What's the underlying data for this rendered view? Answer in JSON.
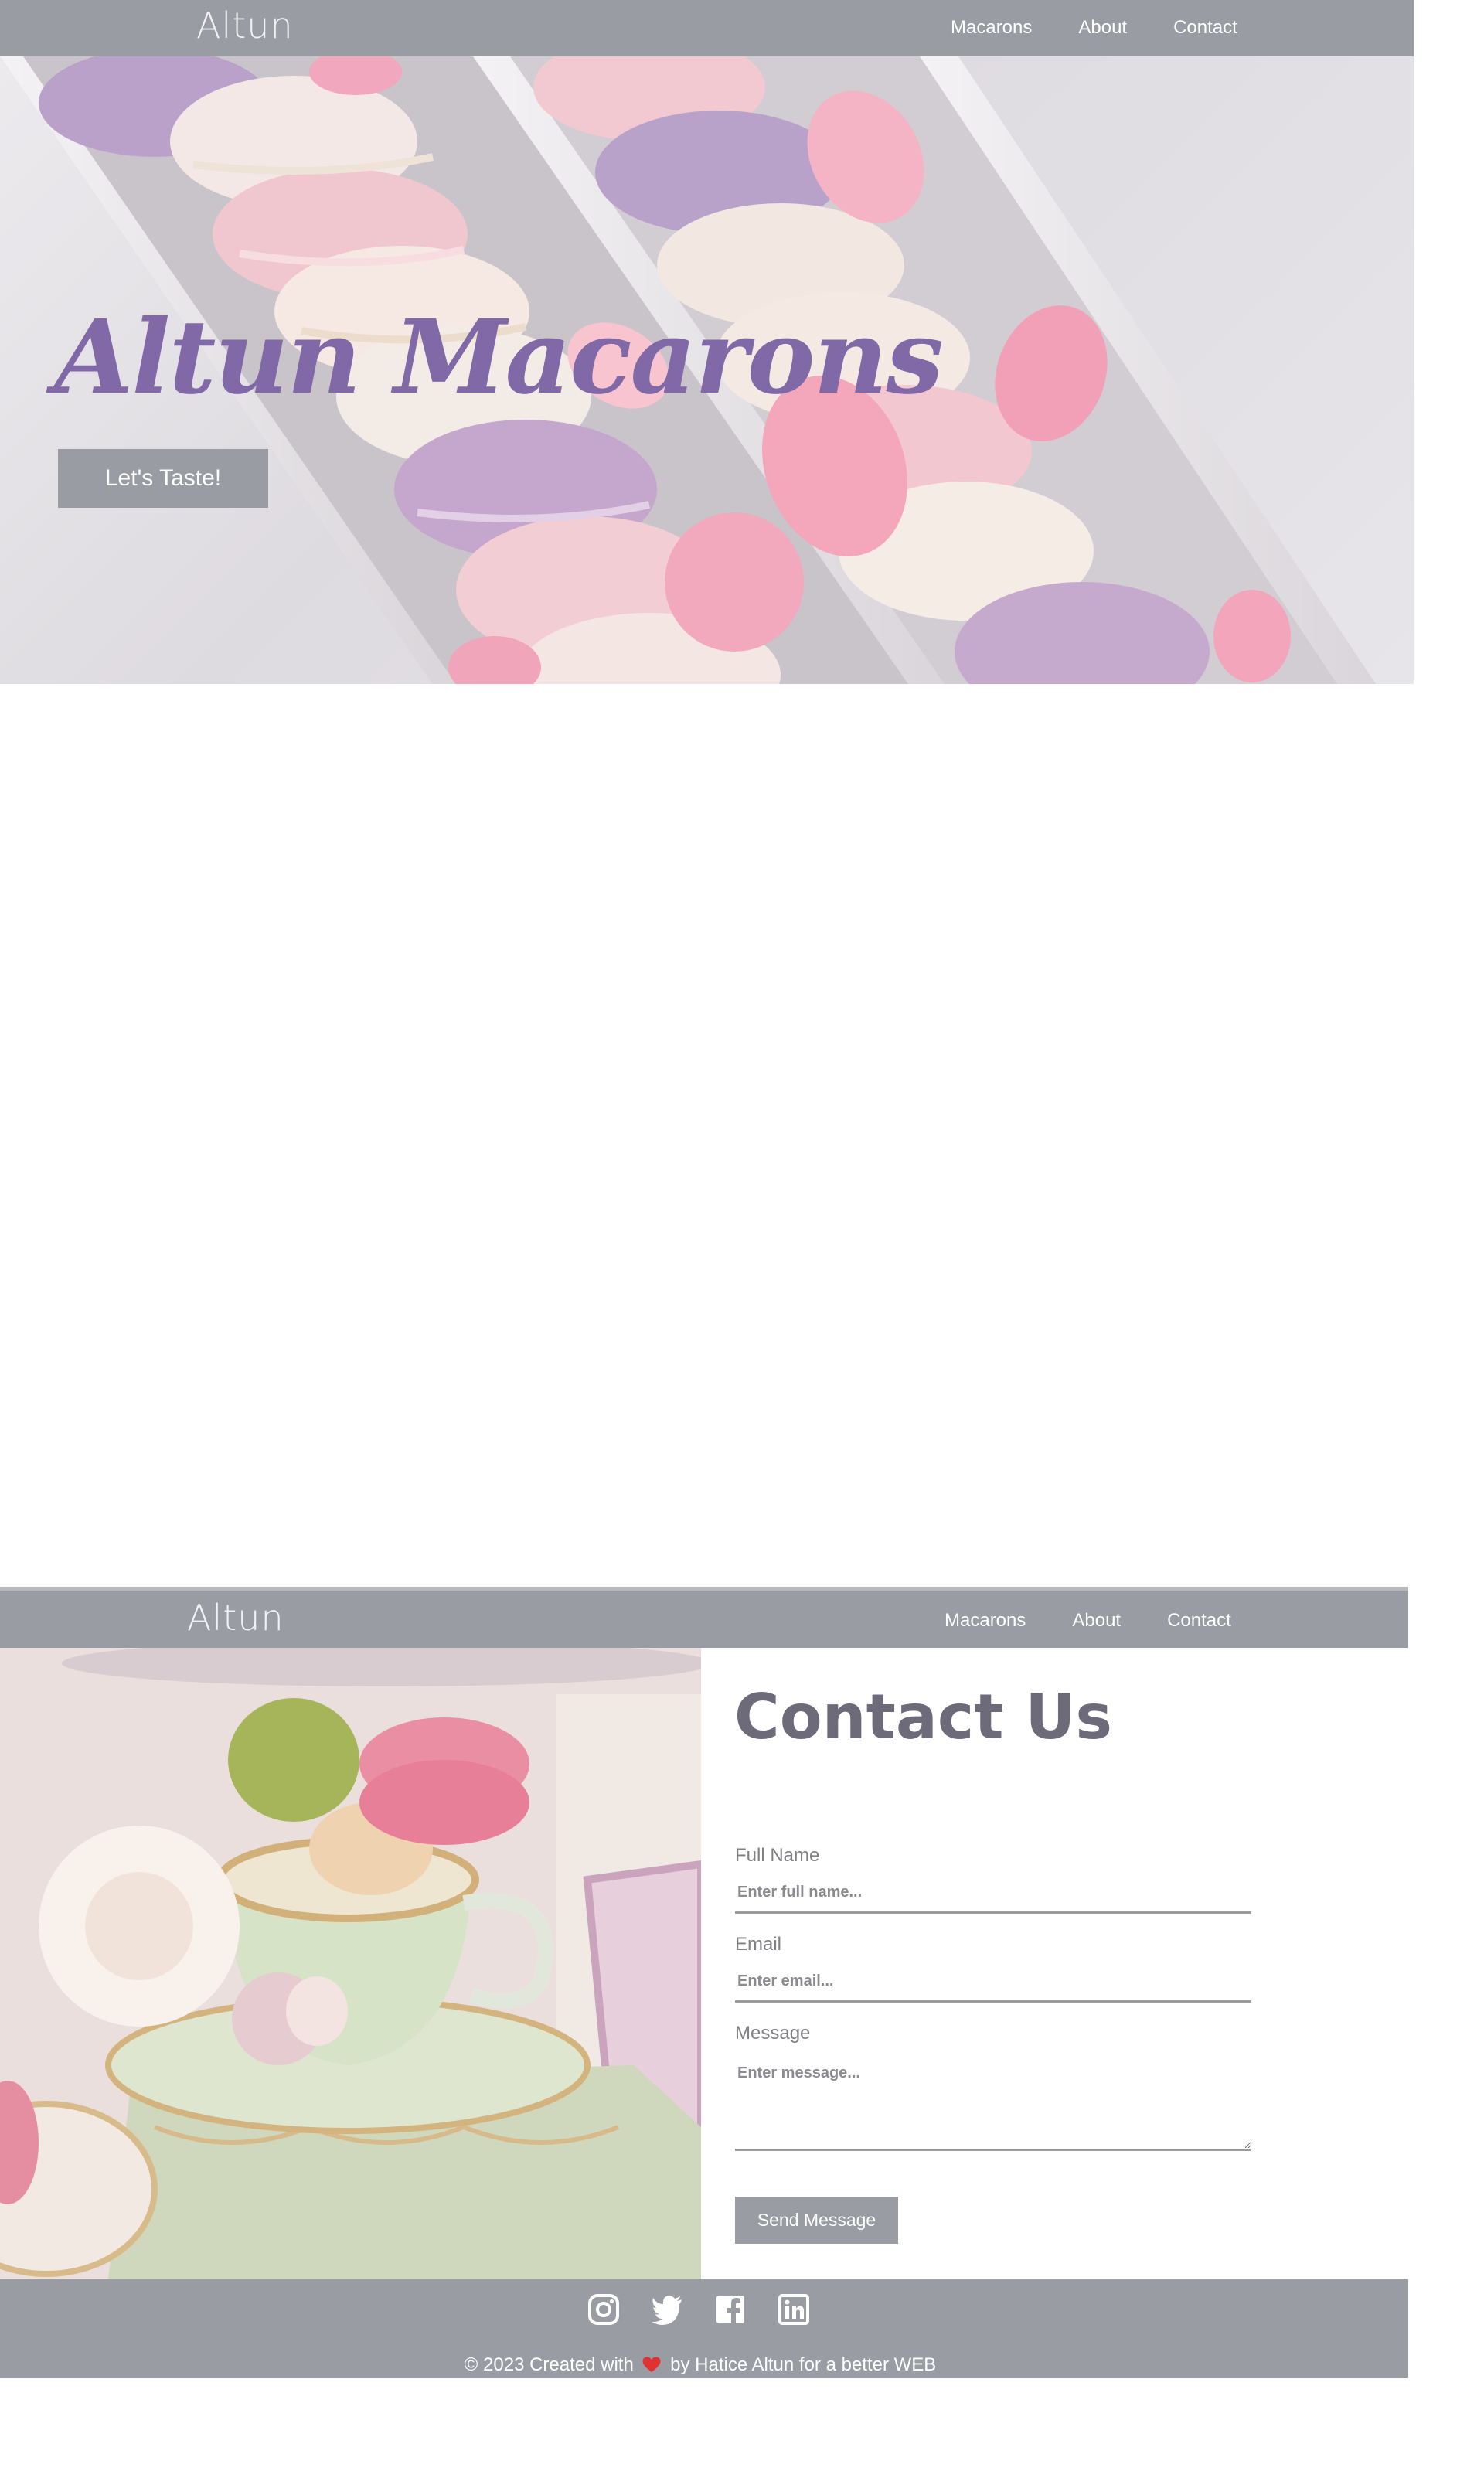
{
  "header": {
    "brand": "Altun",
    "nav": [
      {
        "label": "Macarons"
      },
      {
        "label": "About"
      },
      {
        "label": "Contact"
      }
    ]
  },
  "hero": {
    "title": "Altun Macarons",
    "cta_label": "Let's Taste!"
  },
  "contact": {
    "title": "Contact Us",
    "full_name": {
      "label": "Full Name",
      "placeholder": "Enter full name..."
    },
    "email": {
      "label": "Email",
      "placeholder": "Enter email..."
    },
    "message": {
      "label": "Message",
      "placeholder": "Enter message..."
    },
    "submit_label": "Send Message"
  },
  "footer": {
    "social_icons": [
      "instagram-icon",
      "twitter-icon",
      "facebook-icon",
      "linkedin-icon"
    ],
    "copyright_before": "© 2023 Created with",
    "copyright_after": "by Hatice Altun for a better WEB"
  },
  "colors": {
    "nav_bg": "#9a9ca3",
    "hero_title": "#8168a6",
    "contact_title": "#6d6a7a",
    "heart": "#e03232"
  }
}
